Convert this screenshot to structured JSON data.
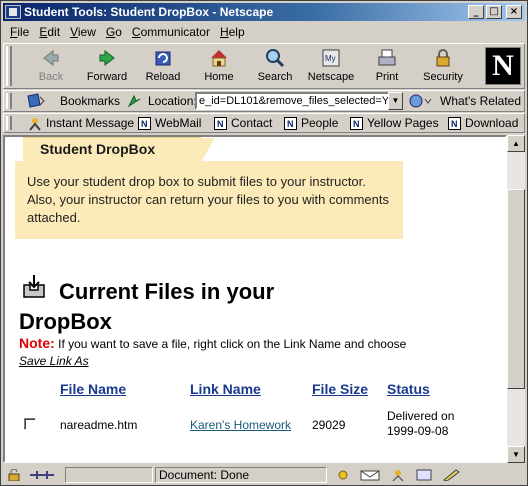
{
  "window": {
    "title": "Student Tools: Student DropBox - Netscape"
  },
  "menu": [
    {
      "label": "File",
      "key": "F"
    },
    {
      "label": "Edit",
      "key": "E"
    },
    {
      "label": "View",
      "key": "V"
    },
    {
      "label": "Go",
      "key": "G"
    },
    {
      "label": "Communicator",
      "key": "C"
    },
    {
      "label": "Help",
      "key": "H"
    }
  ],
  "nav": {
    "back": "Back",
    "forward": "Forward",
    "reload": "Reload",
    "home": "Home",
    "search": "Search",
    "netscape": "Netscape",
    "print": "Print",
    "security": "Security"
  },
  "location": {
    "bookmarks": "Bookmarks",
    "label": "Location:",
    "url": "e_id=DL101&remove_files_selected=Y",
    "whats_related": "What's Related"
  },
  "personal": {
    "instant_message": "Instant Message",
    "webmail": "WebMail",
    "contact": "Contact",
    "people": "People",
    "yellow_pages": "Yellow Pages",
    "download": "Download"
  },
  "page": {
    "tab_title": "Student DropBox",
    "intro": "Use your student drop box to submit files to your instructor. Also, your instructor can return your files to you with comments attached.",
    "heading": "Current Files in your DropBox",
    "note_label": "Note:",
    "note_text": " If you want to save a file, right click on the Link Name and choose ",
    "note_action": "Save Link As",
    "columns": {
      "file": "File Name",
      "link": "Link Name",
      "size": "File Size",
      "status": "Status"
    },
    "rows": [
      {
        "file": "nareadme.htm",
        "link": "Karen's Homework",
        "size": "29029",
        "status": "Delivered on 1999-09-08"
      }
    ]
  },
  "status": {
    "text": "Document: Done"
  },
  "colors": {
    "title_start": "#0a246a",
    "panel": "#fcebb8",
    "link": "#1a3a8c",
    "note": "#e00000"
  }
}
